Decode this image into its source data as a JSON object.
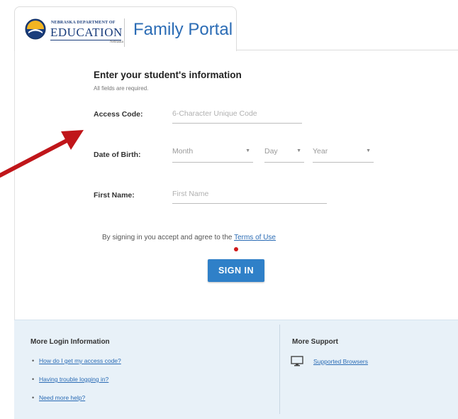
{
  "header": {
    "dept_line": "NEBRASKA DEPARTMENT OF",
    "dept_name": "EDUCATION",
    "dept_small": "Nebraska",
    "portal_title": "Family Portal"
  },
  "form": {
    "heading": "Enter your student's information",
    "subheading": "All fields are required.",
    "access_code": {
      "label": "Access Code:",
      "placeholder": "6-Character Unique Code",
      "value": ""
    },
    "dob": {
      "label": "Date of Birth:",
      "month": "Month",
      "day": "Day",
      "year": "Year"
    },
    "first_name": {
      "label": "First Name:",
      "placeholder": "First Name",
      "value": ""
    },
    "terms_prefix": "By signing in you accept and agree to the",
    "terms_link": "Terms of Use",
    "signin_label": "SIGN IN"
  },
  "footer": {
    "login_info": {
      "heading": "More Login Information",
      "links": [
        "How do I get my access code?",
        "Having trouble logging in?",
        "Need more help?"
      ]
    },
    "support": {
      "heading": "More Support",
      "links": [
        "Supported Browsers"
      ]
    }
  },
  "icons": {
    "caret": "▼",
    "bullet": "•"
  },
  "colors": {
    "accent": "#2f80c8",
    "footer_bg": "#e8f1f8",
    "annotation_arrow": "#c0161a"
  }
}
